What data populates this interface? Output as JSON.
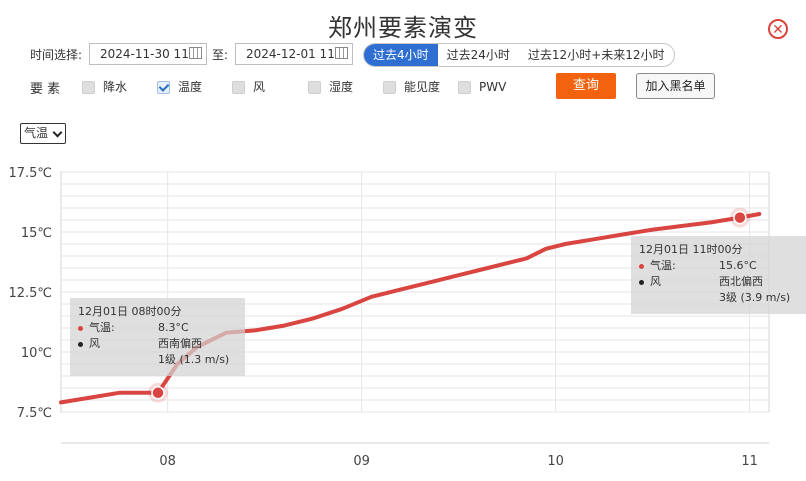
{
  "header": {
    "title": "郑州要素演变",
    "close_icon": "close-icon"
  },
  "query": {
    "time_label": "时间选择:",
    "start_value": "2024-11-30 11",
    "to_label": "至:",
    "end_value": "2024-12-01 11",
    "ranges": [
      {
        "label": "过去4小时",
        "active": true
      },
      {
        "label": "过去24小时",
        "active": false
      },
      {
        "label": "过去12小时+未来12小时",
        "active": false
      }
    ],
    "elements_label": "要 素",
    "elements": [
      {
        "label": "降水",
        "checked": false
      },
      {
        "label": "温度",
        "checked": true
      },
      {
        "label": "风",
        "checked": false
      },
      {
        "label": "湿度",
        "checked": false
      },
      {
        "label": "能见度",
        "checked": false
      },
      {
        "label": "PWV",
        "checked": false
      }
    ],
    "query_button": "查询",
    "blacklist_button": "加入黑名单"
  },
  "variable_select": {
    "value": "气温"
  },
  "colors": {
    "series": "#d94540",
    "accent": "#f2620f",
    "active_tab": "#2f6fd1"
  },
  "chart_data": {
    "type": "line",
    "x_tick_labels": [
      "08",
      "09",
      "10",
      "11"
    ],
    "y_tick_labels": [
      "17.5℃",
      "15℃",
      "12.5℃",
      "10℃",
      "7.5℃"
    ],
    "ylim": [
      7.5,
      17.5
    ],
    "grid": true,
    "series": [
      {
        "name": "气温",
        "x_hours": [
          7.45,
          7.6,
          7.75,
          7.95,
          8.05,
          8.15,
          8.3,
          8.45,
          8.6,
          8.75,
          8.9,
          9.05,
          9.2,
          9.35,
          9.5,
          9.65,
          9.75,
          9.85,
          9.95,
          10.05,
          10.2,
          10.35,
          10.5,
          10.65,
          10.8,
          10.95,
          11.05
        ],
        "values": [
          7.9,
          8.1,
          8.3,
          8.3,
          9.5,
          10.2,
          10.8,
          10.9,
          11.1,
          11.4,
          11.8,
          12.3,
          12.6,
          12.9,
          13.2,
          13.5,
          13.7,
          13.9,
          14.3,
          14.5,
          14.7,
          14.9,
          15.1,
          15.25,
          15.4,
          15.6,
          15.75
        ]
      }
    ],
    "highlights": [
      {
        "title": "12月01日 08时00分",
        "temp_label": "气温:",
        "temp_value": "8.3°C",
        "wind_label": "风",
        "wind_dir": "西南偏西",
        "wind_speed": "1级 (1.3 m/s)",
        "x_hour": 7.95,
        "value": 8.3
      },
      {
        "title": "12月01日 11时00分",
        "temp_label": "气温:",
        "temp_value": "15.6°C",
        "wind_label": "风",
        "wind_dir": "西北偏西",
        "wind_speed": "3级 (3.9 m/s)",
        "x_hour": 10.95,
        "value": 15.6
      }
    ]
  }
}
